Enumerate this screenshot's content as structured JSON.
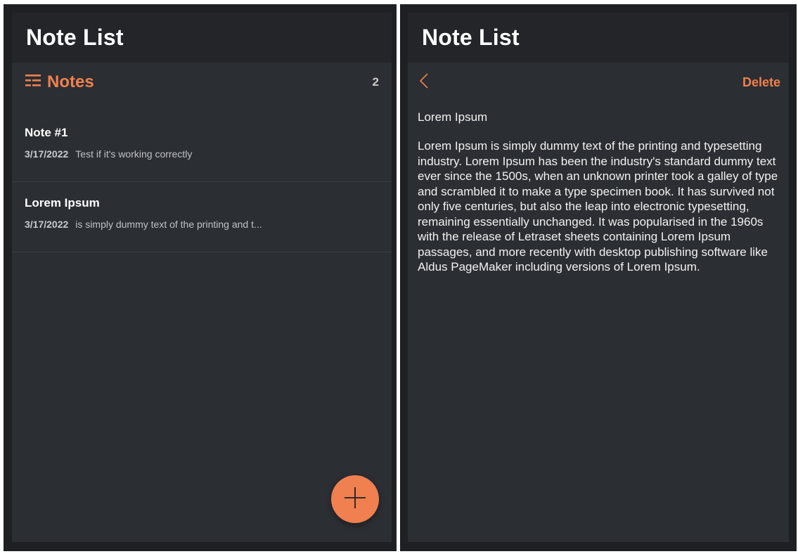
{
  "left_panel": {
    "app_title": "Note List",
    "section_title": "Notes",
    "note_count": "2",
    "notes": [
      {
        "title": "Note #1",
        "date": "3/17/2022",
        "preview": "Test if it's working correctly"
      },
      {
        "title": "Lorem Ipsum",
        "date": "3/17/2022",
        "preview": "is simply dummy text of the printing and t..."
      }
    ],
    "fab_icon": "plus-icon"
  },
  "right_panel": {
    "app_title": "Note List",
    "back_icon": "chevron-left-icon",
    "delete_label": "Delete",
    "note_title": "Lorem Ipsum",
    "note_body": "Lorem Ipsum is simply dummy text of the printing and typesetting industry. Lorem Ipsum has been the industry's standard dummy text ever since the 1500s, when an unknown printer took a galley of type and scrambled it to make a type specimen book. It has survived not only five centuries, but also the leap into electronic typesetting, remaining essentially unchanged. It was popularised in the 1960s with the release of Letraset sheets containing Lorem Ipsum passages, and more recently with desktop publishing software like Aldus PageMaker including versions of Lorem Ipsum."
  },
  "colors": {
    "accent": "#f08050",
    "background": "#2b2e32",
    "appbar": "#232528"
  }
}
